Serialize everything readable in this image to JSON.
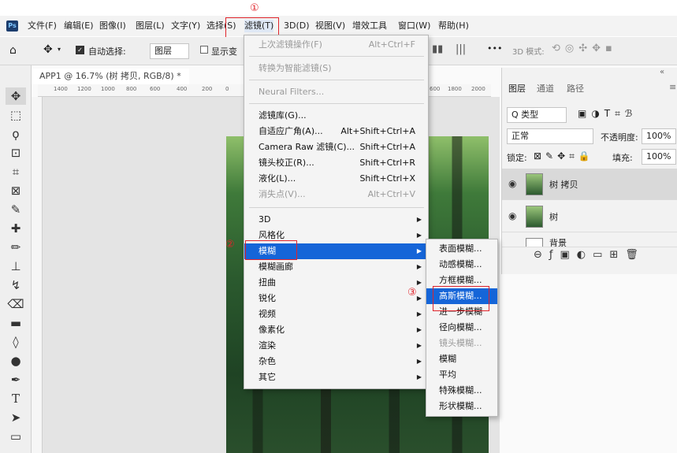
{
  "menubar": {
    "logo": "Ps",
    "items": [
      "文件(F)",
      "编辑(E)",
      "图像(I)",
      "图层(L)",
      "文字(Y)",
      "选择(S)",
      "滤镜(T)",
      "3D(D)",
      "视图(V)",
      "增效工具",
      "窗口(W)",
      "帮助(H)"
    ]
  },
  "options_bar": {
    "auto_select_label": "自动选择:",
    "auto_select_value": "图层",
    "show_transform_label": "显示变",
    "mode_3d_label": "3D 模式:",
    "more": "•••"
  },
  "document": {
    "tab_title": "APP1 @ 16.7% (树 拷贝, RGB/8) *",
    "close": "×",
    "ruler_marks": [
      "1400",
      "1200",
      "1000",
      "800",
      "600",
      "400",
      "200",
      "0"
    ],
    "ruler_marks_right": [
      "600",
      "1800",
      "2000"
    ]
  },
  "filter_menu": {
    "items": [
      {
        "label": "上次滤镜操作(F)",
        "shortcut": "Alt+Ctrl+F",
        "disabled": true
      },
      {
        "label": "转换为智能滤镜(S)",
        "disabled": true
      },
      {
        "label": "Neural Filters...",
        "disabled": true
      },
      {
        "label": "滤镜库(G)..."
      },
      {
        "label": "自适应广角(A)...",
        "shortcut": "Alt+Shift+Ctrl+A"
      },
      {
        "label": "Camera Raw 滤镜(C)...",
        "shortcut": "Shift+Ctrl+A"
      },
      {
        "label": "镜头校正(R)...",
        "shortcut": "Shift+Ctrl+R"
      },
      {
        "label": "液化(L)...",
        "shortcut": "Shift+Ctrl+X"
      },
      {
        "label": "消失点(V)...",
        "shortcut": "Alt+Ctrl+V",
        "disabled": true
      },
      {
        "label": "3D"
      },
      {
        "label": "风格化"
      },
      {
        "label": "模糊",
        "highlighted": true
      },
      {
        "label": "模糊画廊"
      },
      {
        "label": "扭曲"
      },
      {
        "label": "锐化"
      },
      {
        "label": "视频"
      },
      {
        "label": "像素化"
      },
      {
        "label": "渲染"
      },
      {
        "label": "杂色"
      },
      {
        "label": "其它"
      }
    ]
  },
  "blur_submenu": {
    "items": [
      {
        "label": "表面模糊..."
      },
      {
        "label": "动感模糊..."
      },
      {
        "label": "方框模糊..."
      },
      {
        "label": "高斯模糊...",
        "highlighted": true
      },
      {
        "label": "进一步模糊"
      },
      {
        "label": "径向模糊..."
      },
      {
        "label": "镜头模糊...",
        "disabled": true
      },
      {
        "label": "模糊"
      },
      {
        "label": "平均"
      },
      {
        "label": "特殊模糊..."
      },
      {
        "label": "形状模糊..."
      }
    ]
  },
  "layers_panel": {
    "tabs": [
      "图层",
      "通道",
      "路径"
    ],
    "filter_kind": "Q 类型",
    "blend_mode": "正常",
    "opacity_label": "不透明度:",
    "opacity_value": "100%",
    "lock_label": "锁定:",
    "fill_label": "填充:",
    "fill_value": "100%",
    "layers": [
      "树 拷贝",
      "树",
      "背景"
    ],
    "collapse": "«",
    "menu": "≡"
  },
  "annotations": [
    "①",
    "②",
    "③"
  ],
  "colors": {
    "highlight": "#1565d8",
    "annotation": "#e0242b"
  }
}
